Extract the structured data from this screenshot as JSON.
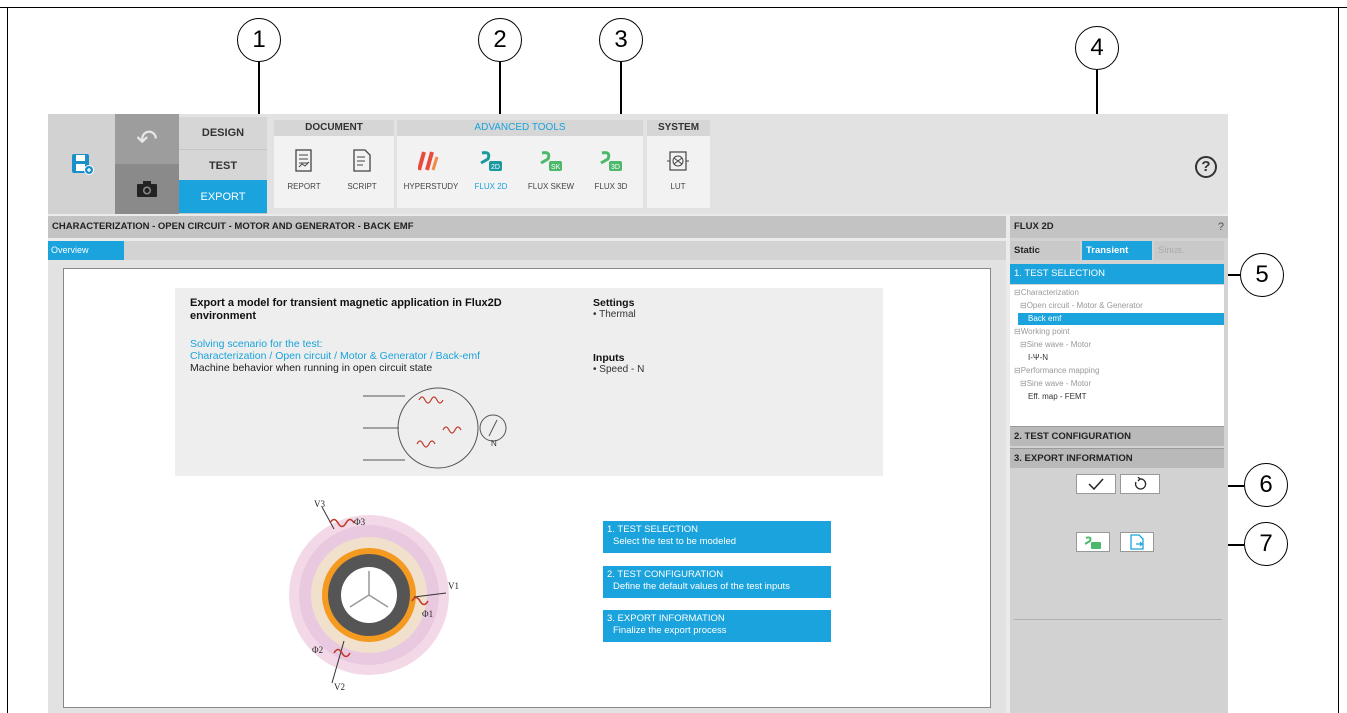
{
  "callouts": [
    "1",
    "2",
    "3",
    "4",
    "5",
    "6",
    "7"
  ],
  "ribbon": {
    "modes": [
      "DESIGN",
      "TEST",
      "EXPORT"
    ],
    "groups": {
      "document": {
        "title": "DOCUMENT",
        "tools": [
          "REPORT",
          "SCRIPT"
        ]
      },
      "advanced": {
        "title": "ADVANCED TOOLS",
        "tools": [
          "HYPERSTUDY",
          "FLUX 2D",
          "FLUX SKEW",
          "FLUX 3D"
        ]
      },
      "system": {
        "title": "SYSTEM",
        "tools": [
          "LUT"
        ]
      }
    },
    "help": "?"
  },
  "main": {
    "title": "CHARACTERIZATION - OPEN CIRCUIT - MOTOR AND GENERATOR - BACK EMF",
    "tab": "Overview",
    "info": {
      "title": "Export a model for transient magnetic application in Flux2D environment",
      "scenario_label": "Solving scenario for the test:",
      "scenario_path": "Characterization / Open circuit / Motor & Generator / Back-emf",
      "behavior": "Machine behavior when running in open circuit state",
      "settings_h": "Settings",
      "settings_v": "• Thermal",
      "inputs_h": "Inputs",
      "inputs_v": "• Speed - N"
    },
    "steps": [
      {
        "title": "1. TEST SELECTION",
        "desc": "Select the test to be modeled"
      },
      {
        "title": "2. TEST CONFIGURATION",
        "desc": "Define the default values of the test inputs"
      },
      {
        "title": "3. EXPORT INFORMATION",
        "desc": "Finalize the export process"
      }
    ],
    "diagram_labels": {
      "v1": "V1",
      "v2": "V2",
      "v3": "V3",
      "phi1": "Φ1",
      "phi2": "Φ2",
      "phi3": "Φ3",
      "n": "N"
    }
  },
  "right_panel": {
    "title": "FLUX 2D",
    "help": "?",
    "tabs": [
      "Static",
      "Transient",
      "Sinus."
    ],
    "sections": [
      "1. TEST SELECTION",
      "2. TEST CONFIGURATION",
      "3. EXPORT INFORMATION"
    ],
    "tree": [
      "⊟Characterization",
      "⊟Open circuit - Motor & Generator",
      "Back emf",
      "⊟Working point",
      "⊟Sine wave - Motor",
      "I-Ψ-N",
      "⊟Performance mapping",
      "⊟Sine wave - Motor",
      "Eff. map - FEMT"
    ]
  }
}
